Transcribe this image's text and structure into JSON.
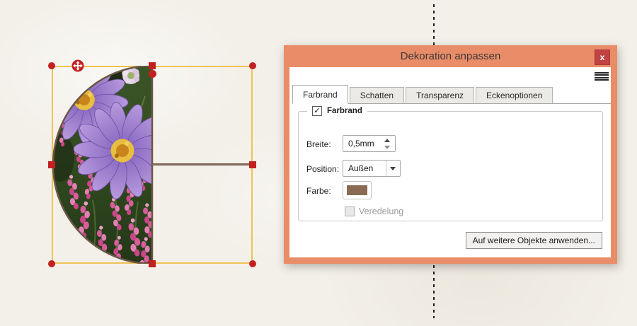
{
  "canvas": {
    "selection": {
      "border_color": "#efc255",
      "handle_color": "#c32020",
      "move_icon": "move-4-way-arrows",
      "rotate_icon": "rotate-handle-dot"
    },
    "decoration": {
      "border_color": "#6b5847"
    }
  },
  "dialog": {
    "title": "Dekoration anpassen",
    "close_label": "x",
    "menu_icon": "hamburger-menu",
    "accent_color": "#e98c68",
    "tabs": [
      {
        "label": "Farbrand",
        "active": true
      },
      {
        "label": "Schatten",
        "active": false
      },
      {
        "label": "Transparenz",
        "active": false
      },
      {
        "label": "Eckenoptionen",
        "active": false
      }
    ],
    "group": {
      "legend": "Farbrand",
      "checkbox_checked": true,
      "check_glyph": "✓"
    },
    "fields": {
      "breite_label": "Breite:",
      "breite_value": "0,5mm",
      "position_label": "Position:",
      "position_value": "Außen",
      "farbe_label": "Farbe:",
      "farbe_color": "#8a6a52",
      "veredelung_label": "Veredelung",
      "veredelung_enabled": false
    },
    "apply_button": "Auf weitere Objekte anwenden..."
  }
}
